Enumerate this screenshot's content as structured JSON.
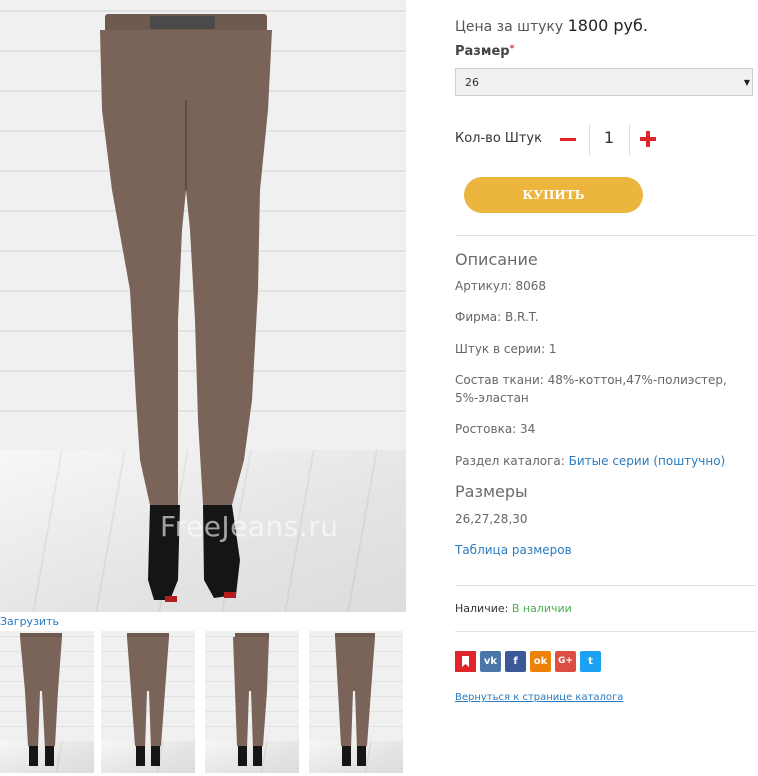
{
  "gallery": {
    "watermark": "FreeJeans.ru",
    "upload_link": "Загрузить",
    "thumbnails": [
      "thumb-front-belt",
      "thumb-front",
      "thumb-back-side",
      "thumb-back"
    ]
  },
  "product": {
    "price_label": "Цена за штуку",
    "price_value": "1800 руб.",
    "size_label": "Размер",
    "size_required_mark": "*",
    "size_selected": "26",
    "qty_label": "Кол-во Штук",
    "qty_value": "1",
    "buy_label": "КУПИТЬ"
  },
  "description": {
    "title": "Описание",
    "article": "Артикул: 8068",
    "brand": "Фирма: B.R.T.",
    "pcs_in_series": "Штук в серии: 1",
    "fabric": "Состав ткани: 48%-коттон,47%-полиэстер, 5%-эластан",
    "height": "Ростовка: 34",
    "catalog_label": "Раздел каталога:",
    "catalog_link": "Битые серии (поштучно)"
  },
  "sizes": {
    "title": "Размеры",
    "list": "26,27,28,30",
    "table_link": "Таблица размеров"
  },
  "availability": {
    "label": "Наличие:",
    "value": "В наличии"
  },
  "social": [
    {
      "name": "bookmark",
      "glyph": "",
      "color": "#e0262a"
    },
    {
      "name": "vk",
      "glyph": "vk",
      "color": "#4a76a8"
    },
    {
      "name": "facebook",
      "glyph": "f",
      "color": "#3b5998"
    },
    {
      "name": "odnoklassniki",
      "glyph": "ok",
      "color": "#ee8208"
    },
    {
      "name": "googleplus",
      "glyph": "G+",
      "color": "#dc4e41"
    },
    {
      "name": "twitter",
      "glyph": "t",
      "color": "#1da1f2"
    }
  ],
  "back_link": "Вернуться к странице каталога"
}
